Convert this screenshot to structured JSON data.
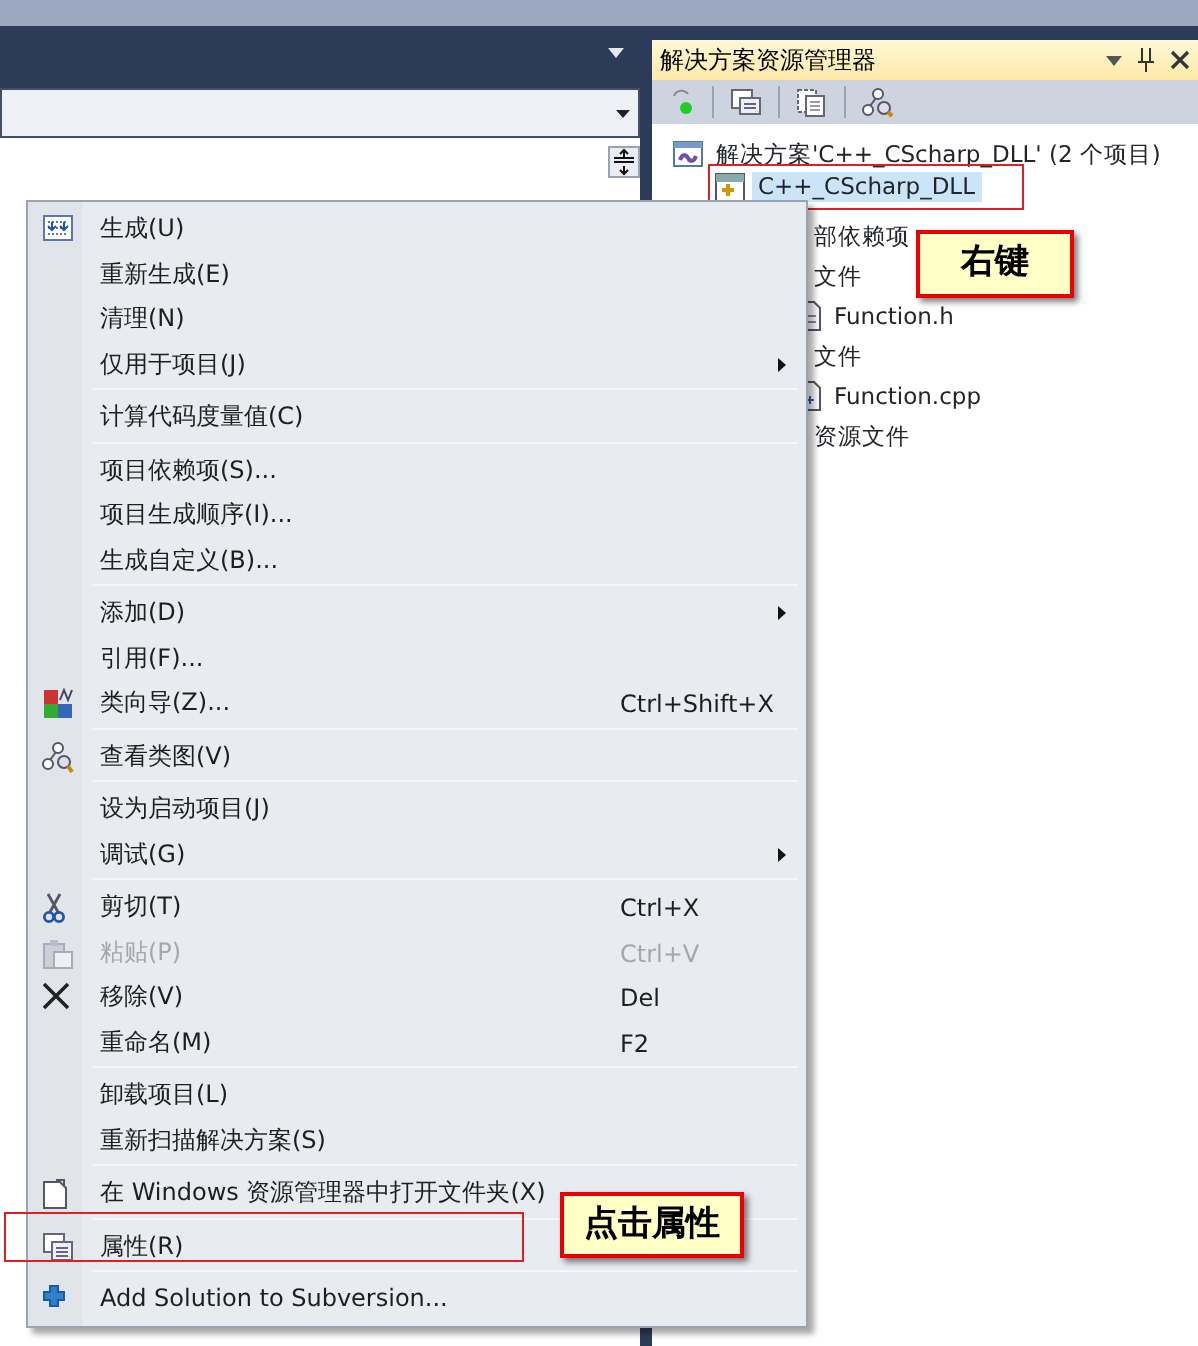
{
  "solution_explorer": {
    "title": "解决方案资源管理器",
    "tree": [
      {
        "label": "解决方案'C++_CScharp_DLL' (2 个项目)",
        "kind": "solution",
        "selected": false,
        "children": [
          {
            "label": "C++_CScharp_DLL",
            "kind": "project",
            "selected": true,
            "children": [
              {
                "label": "部依赖项",
                "kind": "covered",
                "selected": false
              },
              {
                "label": "文件",
                "kind": "covered",
                "selected": false,
                "children": [
                  {
                    "label": "Function.h",
                    "kind": "header",
                    "selected": false
                  }
                ]
              },
              {
                "label": "文件",
                "kind": "covered",
                "selected": false,
                "children": [
                  {
                    "label": "Function.cpp",
                    "kind": "source",
                    "selected": false
                  }
                ]
              },
              {
                "label": "资源文件",
                "kind": "covered",
                "selected": false
              }
            ]
          }
        ]
      }
    ]
  },
  "context_menu": [
    {
      "kind": "item",
      "label": "生成(U)",
      "submenu": false,
      "disabled": false
    },
    {
      "kind": "item",
      "label": "重新生成(E)",
      "submenu": false,
      "disabled": false
    },
    {
      "kind": "item",
      "label": "清理(N)",
      "submenu": false,
      "disabled": false
    },
    {
      "kind": "item",
      "label": "仅用于项目(J)",
      "submenu": true,
      "disabled": false
    },
    {
      "kind": "separator"
    },
    {
      "kind": "item",
      "label": "计算代码度量值(C)",
      "submenu": false,
      "disabled": false
    },
    {
      "kind": "separator"
    },
    {
      "kind": "item",
      "label": "项目依赖项(S)...",
      "submenu": false,
      "disabled": false
    },
    {
      "kind": "item",
      "label": "项目生成顺序(I)...",
      "submenu": false,
      "disabled": false
    },
    {
      "kind": "item",
      "label": "生成自定义(B)...",
      "submenu": false,
      "disabled": false
    },
    {
      "kind": "separator"
    },
    {
      "kind": "item",
      "label": "添加(D)",
      "submenu": true,
      "disabled": false
    },
    {
      "kind": "item",
      "label": "引用(F)...",
      "submenu": false,
      "disabled": false
    },
    {
      "kind": "item",
      "label": "类向导(Z)...",
      "shortcut": "Ctrl+Shift+X",
      "submenu": false,
      "disabled": false
    },
    {
      "kind": "separator"
    },
    {
      "kind": "item",
      "label": "查看类图(V)",
      "submenu": false,
      "disabled": false
    },
    {
      "kind": "separator"
    },
    {
      "kind": "item",
      "label": "设为启动项目(J)",
      "submenu": false,
      "disabled": false
    },
    {
      "kind": "item",
      "label": "调试(G)",
      "submenu": true,
      "disabled": false
    },
    {
      "kind": "separator"
    },
    {
      "kind": "item",
      "label": "剪切(T)",
      "shortcut": "Ctrl+X",
      "submenu": false,
      "disabled": false
    },
    {
      "kind": "item",
      "label": "粘贴(P)",
      "shortcut": "Ctrl+V",
      "submenu": false,
      "disabled": true
    },
    {
      "kind": "item",
      "label": "移除(V)",
      "shortcut": "Del",
      "submenu": false,
      "disabled": false
    },
    {
      "kind": "item",
      "label": "重命名(M)",
      "shortcut": "F2",
      "submenu": false,
      "disabled": false
    },
    {
      "kind": "separator"
    },
    {
      "kind": "item",
      "label": "卸载项目(L)",
      "submenu": false,
      "disabled": false
    },
    {
      "kind": "item",
      "label": "重新扫描解决方案(S)",
      "submenu": false,
      "disabled": false
    },
    {
      "kind": "separator"
    },
    {
      "kind": "item",
      "label": "在 Windows 资源管理器中打开文件夹(X)",
      "submenu": false,
      "disabled": false
    },
    {
      "kind": "separator"
    },
    {
      "kind": "item",
      "label": "属性(R)",
      "submenu": false,
      "disabled": false
    },
    {
      "kind": "separator"
    },
    {
      "kind": "item",
      "label": "Add Solution to Subversion...",
      "submenu": false,
      "disabled": false
    }
  ],
  "callouts": [
    {
      "text": "右键"
    },
    {
      "text": "点击属性"
    }
  ]
}
